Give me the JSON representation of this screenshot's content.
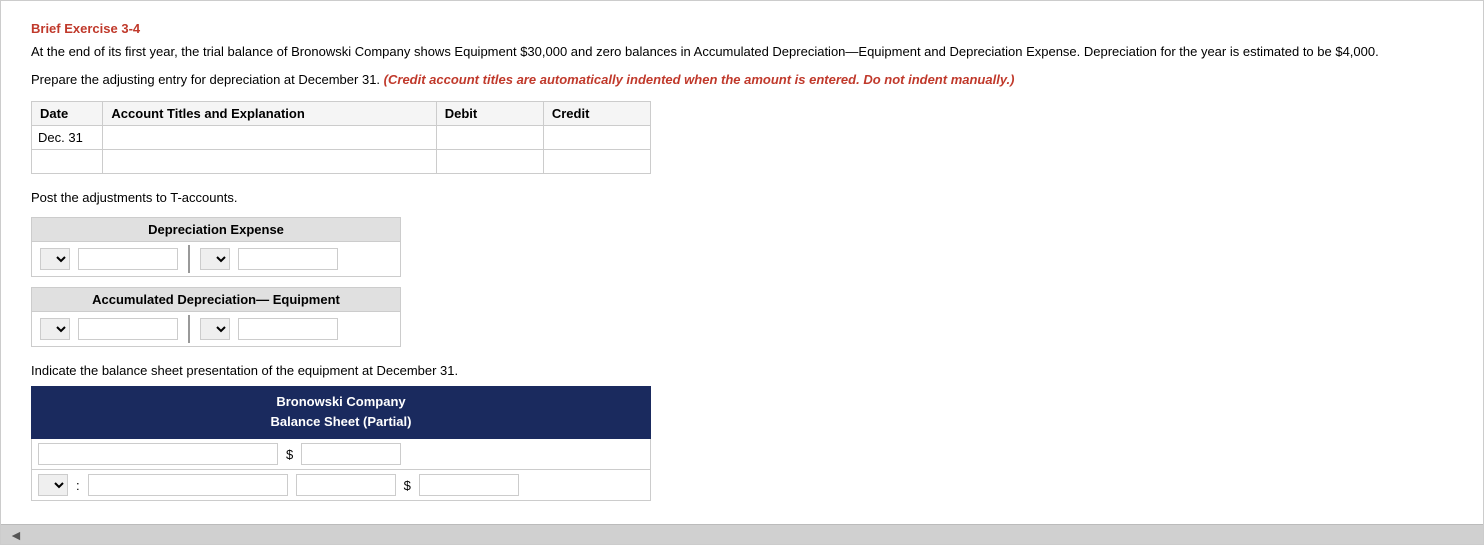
{
  "title": "Brief Exercise 3-4",
  "description": "At the end of its first year, the trial balance of Bronowski Company shows Equipment $30,000 and zero balances in Accumulated Depreciation—Equipment and Depreciation Expense. Depreciation for the year is estimated to be $4,000.",
  "instruction_prefix": "Prepare the adjusting entry for depreciation at December 31.",
  "instruction_italic": "(Credit account titles are automatically indented when the amount is entered. Do not indent manually.)",
  "journal": {
    "columns": {
      "date": "Date",
      "account": "Account Titles and Explanation",
      "debit": "Debit",
      "credit": "Credit"
    },
    "rows": [
      {
        "date": "Dec. 31",
        "account": "",
        "debit": "",
        "credit": ""
      },
      {
        "date": "",
        "account": "",
        "debit": "",
        "credit": ""
      }
    ]
  },
  "post_label": "Post the adjustments to T-accounts.",
  "t_accounts": [
    {
      "name": "Depreciation Expense",
      "rows": [
        {
          "left_select": "",
          "left_input": "",
          "right_select": "",
          "right_input": ""
        }
      ]
    },
    {
      "name": "Accumulated Depreciation— Equipment",
      "rows": [
        {
          "left_select": "",
          "left_input": "",
          "right_select": "",
          "right_input": ""
        }
      ]
    }
  ],
  "balance_sheet": {
    "label": "Indicate the balance sheet presentation of the equipment at December 31.",
    "header_line1": "Bronowski Company",
    "header_line2": "Balance Sheet (Partial)",
    "rows": [
      {
        "type": "account_dollar",
        "account": "",
        "dollar": "$",
        "amount": ""
      },
      {
        "type": "select_account_dollar",
        "account": "",
        "dollar": "$",
        "amount": ""
      }
    ]
  },
  "footer": {
    "scroll_arrow": "◄"
  }
}
